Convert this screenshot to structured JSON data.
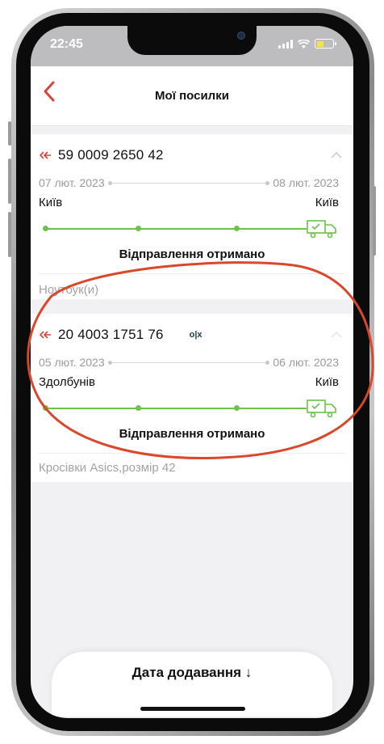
{
  "status_bar": {
    "time": "22:45"
  },
  "header": {
    "title": "Мої посилки"
  },
  "parcels": [
    {
      "tracking_number": "59 0009 2650 42",
      "date_sent": "07 лют. 2023",
      "date_received": "08 лют. 2023",
      "city_from": "Київ",
      "city_to": "Київ",
      "status": "Відправлення отримано",
      "description": "Ноутбук(и)"
    },
    {
      "tracking_number": "20 4003 1751 76",
      "badge": "o|x",
      "date_sent": "05 лют. 2023",
      "date_received": "06 лют. 2023",
      "city_from": "Здолбунів",
      "city_to": "Київ",
      "status": "Відправлення отримано",
      "description": "Кросівки Asics,розмір 42"
    }
  ],
  "sort": {
    "label": "Дата додавання ↓"
  },
  "colors": {
    "accent_red": "#d4463a",
    "progress_green": "#6cc24a",
    "annotation_red": "#d9482b"
  },
  "icons": {
    "back": "chevron-left-icon",
    "direction": "double-arrow-left-icon",
    "collapse": "chevron-up-icon",
    "truck": "delivery-truck-icon"
  }
}
